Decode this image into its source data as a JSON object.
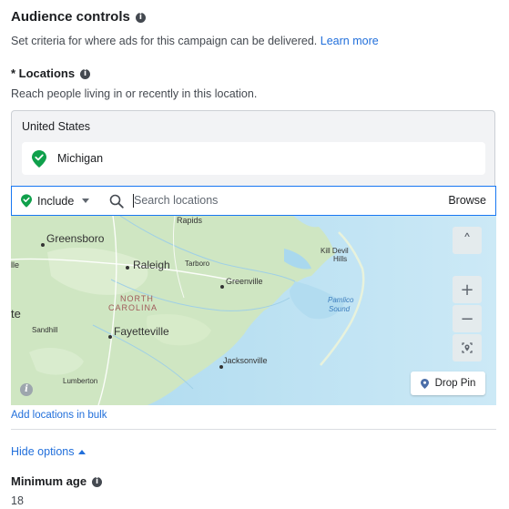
{
  "audience": {
    "title": "Audience controls",
    "info_icon": "i",
    "description": "Set criteria for where ads for this campaign can be delivered.",
    "learn_more": "Learn more"
  },
  "locations": {
    "title": "* Locations",
    "description": "Reach people living in or recently in this location.",
    "country": "United States",
    "selected": [
      {
        "label": "Michigan",
        "icon": "green-location-pin-icon"
      }
    ],
    "include_label": "Include",
    "search_placeholder": "Search locations",
    "browse_label": "Browse",
    "bulk_link": "Add locations in bulk"
  },
  "map": {
    "labels": {
      "rapids": "Rapids",
      "greensboro": "Greensboro",
      "ile": "lle",
      "raleigh": "Raleigh",
      "tarboro": "Tarboro",
      "greenville": "Greenville",
      "kill_devil_1": "Kill Devil",
      "kill_devil_2": "Hills",
      "north": "NORTH",
      "carolina": "CAROLINA",
      "pamlico_1": "Pamlico",
      "pamlico_2": "Sound",
      "te": "te",
      "sandhill": "Sandhill",
      "fayetteville": "Fayetteville",
      "jacksonville": "Jacksonville",
      "lumberton": "Lumberton"
    },
    "controls": {
      "collapse": "˄",
      "zoom_in": "+",
      "zoom_out": "−"
    },
    "drop_pin_label": "Drop Pin",
    "info_badge": "i"
  },
  "options": {
    "hide_label": "Hide options",
    "min_age_label": "Minimum age",
    "min_age_info": "i",
    "min_age_value": "18"
  },
  "colors": {
    "accent": "#1877f2",
    "link": "#216fdb",
    "pin_green": "#0fa04b",
    "land": "#cfe6c2",
    "water": "#bfe2f3"
  }
}
